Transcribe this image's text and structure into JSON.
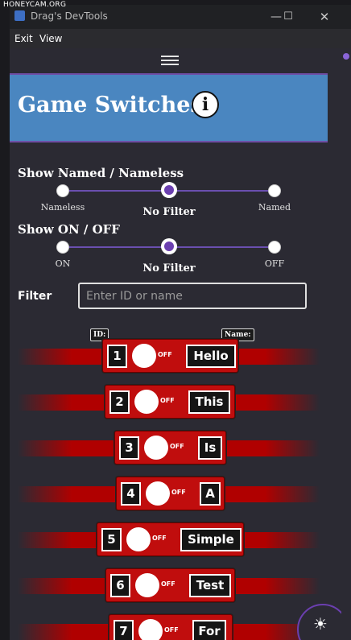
{
  "watermark": "HONEYCAM.ORG",
  "window": {
    "title": "Drag's DevTools"
  },
  "menu": {
    "exit": "Exit",
    "view": "View"
  },
  "banner": {
    "title": "Game Switches"
  },
  "show_named": {
    "title": "Show Named / Nameless",
    "options": [
      "Nameless",
      "No Filter",
      "Named"
    ],
    "selected": "No Filter"
  },
  "show_onoff": {
    "title": "Show ON / OFF",
    "options": [
      "ON",
      "No Filter",
      "OFF"
    ],
    "selected": "No Filter"
  },
  "filter": {
    "label": "Filter",
    "placeholder": "Enter ID or name"
  },
  "column_tags": {
    "id": "ID:",
    "name": "Name:"
  },
  "switches": [
    {
      "id": "1",
      "state": "OFF",
      "name": "Hello"
    },
    {
      "id": "2",
      "state": "OFF",
      "name": "This"
    },
    {
      "id": "3",
      "state": "OFF",
      "name": "Is"
    },
    {
      "id": "4",
      "state": "OFF",
      "name": "A"
    },
    {
      "id": "5",
      "state": "OFF",
      "name": "Simple"
    },
    {
      "id": "6",
      "state": "OFF",
      "name": "Test"
    },
    {
      "id": "7",
      "state": "OFF",
      "name": "For"
    }
  ],
  "colors": {
    "banner": "#4a86c0",
    "accent": "#6b3fb0",
    "switch_off": "#c00d0d"
  }
}
